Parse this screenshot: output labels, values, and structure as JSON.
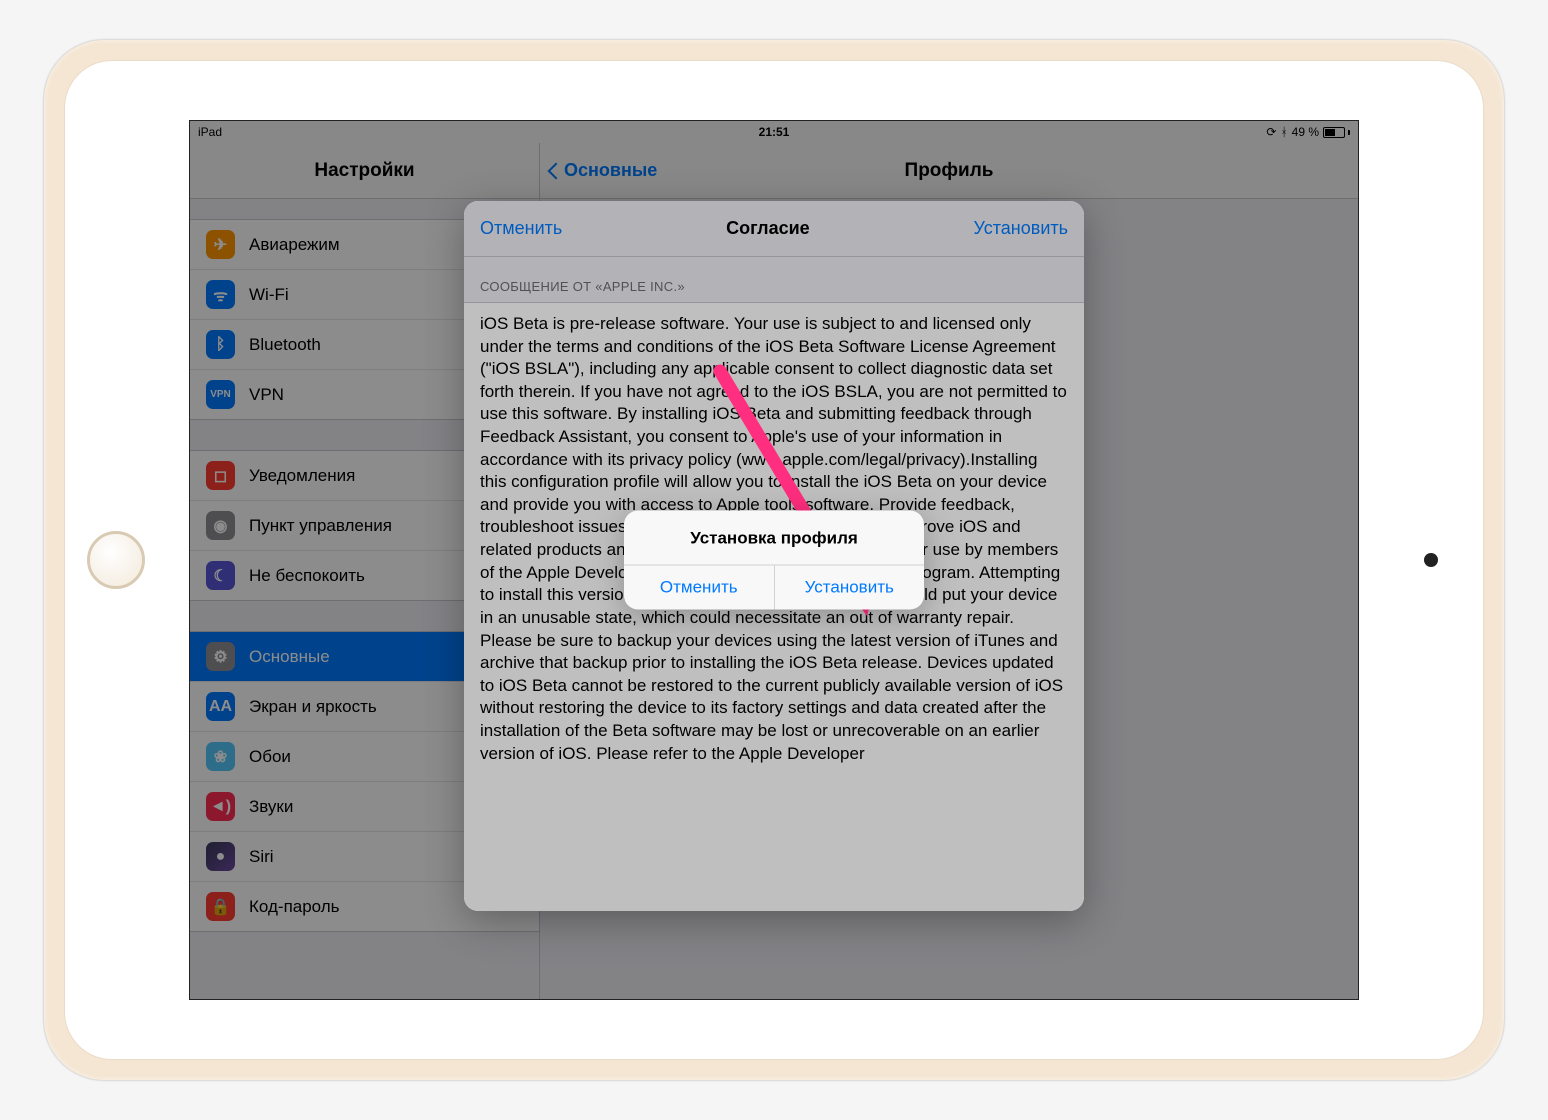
{
  "statusbar": {
    "device": "iPad",
    "time": "21:51",
    "battery_pct": "49 %"
  },
  "sidebar": {
    "title": "Настройки",
    "group1": [
      {
        "label": "Авиарежим",
        "icon": "airplane"
      },
      {
        "label": "Wi-Fi",
        "icon": "wifi"
      },
      {
        "label": "Bluetooth",
        "icon": "bt"
      },
      {
        "label": "VPN",
        "icon": "vpn"
      }
    ],
    "group2": [
      {
        "label": "Уведомления",
        "icon": "notif"
      },
      {
        "label": "Пункт управления",
        "icon": "cc"
      },
      {
        "label": "Не беспокоить",
        "icon": "dnd"
      }
    ],
    "group3": [
      {
        "label": "Основные",
        "icon": "gen",
        "selected": true
      },
      {
        "label": "Экран и яркость",
        "icon": "disp"
      },
      {
        "label": "Обои",
        "icon": "wall"
      },
      {
        "label": "Звуки",
        "icon": "sound"
      },
      {
        "label": "Siri",
        "icon": "siri"
      },
      {
        "label": "Код-пароль",
        "icon": "code"
      }
    ]
  },
  "detail": {
    "back": "Основные",
    "title": "Профиль"
  },
  "sheet": {
    "cancel": "Отменить",
    "title": "Согласие",
    "install": "Установить",
    "section": "СООБЩЕНИЕ ОТ «APPLE INC.»",
    "body": "iOS Beta is pre-release software.  Your use is subject to and licensed only under the terms and conditions of the iOS Beta Software License Agreement (\"iOS BSLA\"), including any applicable consent to collect diagnostic data set forth therein.  If you have not agreed to the iOS BSLA, you are not permitted to use this software. By installing iOS Beta and submitting feedback through Feedback Assistant, you consent to Apple's use of your information in accordance with its privacy policy (www.apple.com/legal/privacy).Installing this configuration profile will allow you to install the iOS Beta on your device and provide you with access to Apple tools software.  Provide feedback, troubleshoot issues with your device and help Apple to improve iOS and related products and services.This version of iOS is only for use by members of the Apple Developer Program or Apple Beta Software Program. Attempting to install this version of iOS in an unauthorized manner could put your device in an unusable state, which could necessitate an out of warranty repair. Please be sure to backup your devices using the latest version of iTunes and archive that backup prior to installing the iOS Beta release.  Devices updated to iOS Beta cannot be restored to the current publicly available version of iOS without restoring the device to its factory settings and data created after the installation of the Beta software may be lost or unrecoverable on an earlier version of iOS.  Please refer to the Apple Developer"
  },
  "alert": {
    "title": "Установка профиля",
    "cancel": "Отменить",
    "install": "Установить"
  },
  "icons": {
    "airplane": "✈",
    "wifi": "ᯤ",
    "bt": "ᛒ",
    "vpn": "VPN",
    "notif": "◻",
    "cc": "◉",
    "dnd": "☾",
    "gen": "⚙",
    "disp": "AA",
    "wall": "❀",
    "sound": "◄)",
    "siri": "●",
    "code": "🔒"
  }
}
